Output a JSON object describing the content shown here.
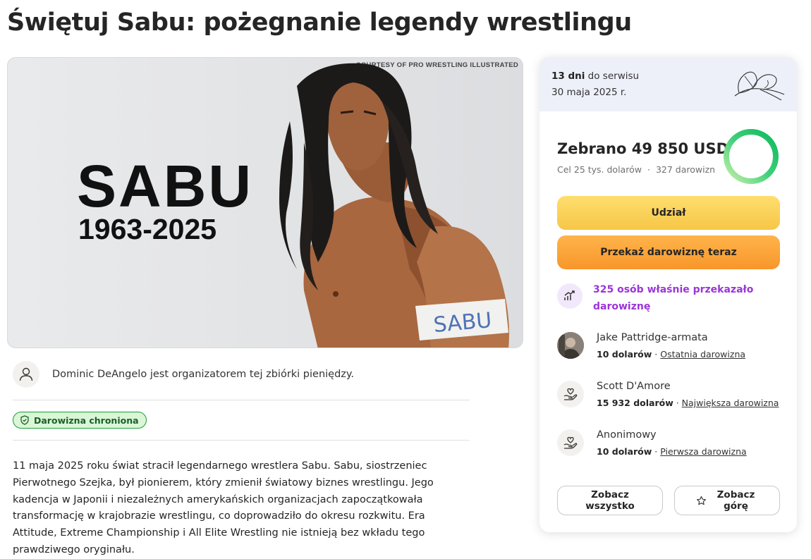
{
  "page": {
    "title": "Świętuj Sabu: pożegnanie legendy wrestlingu"
  },
  "hero": {
    "credit": "COURTESY OF PRO WRESTLING ILLUSTRATED",
    "name": "SABU",
    "years": "1963-2025",
    "armband_text": "SABU"
  },
  "organizer": {
    "text": "Dominic DeAngelo jest organizatorem tej zbiórki pieniędzy.",
    "icon": "user-icon"
  },
  "protection": {
    "label": "Darowizna chroniona",
    "icon": "shield-check-icon",
    "color": "#1c9a3a"
  },
  "story": {
    "text": "11 maja 2025 roku świat stracił legendarnego wrestlera Sabu. Sabu, siostrzeniec Pierwotnego Szejka, był pionierem, który zmienił światowy biznes wrestlingu. Jego kadencja w Japonii i niezależnych amerykańskich organizacjach zapoczątkowała transformację w krajobrazie wrestlingu, co doprowadziło do okresu rozkwitu. Era Attitude, Extreme Championship i All Elite Wrestling nie istnieją bez wkładu tego prawdziwego oryginału."
  },
  "sidebar": {
    "days_bold": "13 dni",
    "days_rest": " do serwisu",
    "date": "30 maja 2025 r.",
    "raised": "Zebrano 49 850 USD",
    "goal": "Cel 25 tys. dolarów",
    "donations_count": "327 darowizn",
    "progress_fraction": 1.0,
    "progress_color": "#1ec26a",
    "share_button": "Udział",
    "donate_button": "Przekaż darowiznę teraz",
    "trend_text": "325 osób właśnie przekazało darowiznę",
    "trend_color": "#9b35d8",
    "donors": [
      {
        "name": "Jake Pattridge-armata",
        "amount": "10 dolarów",
        "separator": " · ",
        "tag": "Ostatnia darowizna",
        "icon": "photo-avatar"
      },
      {
        "name": "Scott D'Amore",
        "amount": "15 932 dolarów",
        "separator": " · ",
        "tag": "Największa darowizna",
        "icon": "heart-hand-icon"
      },
      {
        "name": "Anonimowy",
        "amount": "10 dolarów",
        "separator": " · ",
        "tag": "Pierwsza darowizna",
        "icon": "heart-hand-icon"
      }
    ],
    "see_all_button": "Zobacz wszystko",
    "see_top_button": "Zobacz górę"
  },
  "colors": {
    "share_yellow": "#f6c647",
    "donate_orange": "#f7962b",
    "card_top_bg": "#eef0f9"
  }
}
